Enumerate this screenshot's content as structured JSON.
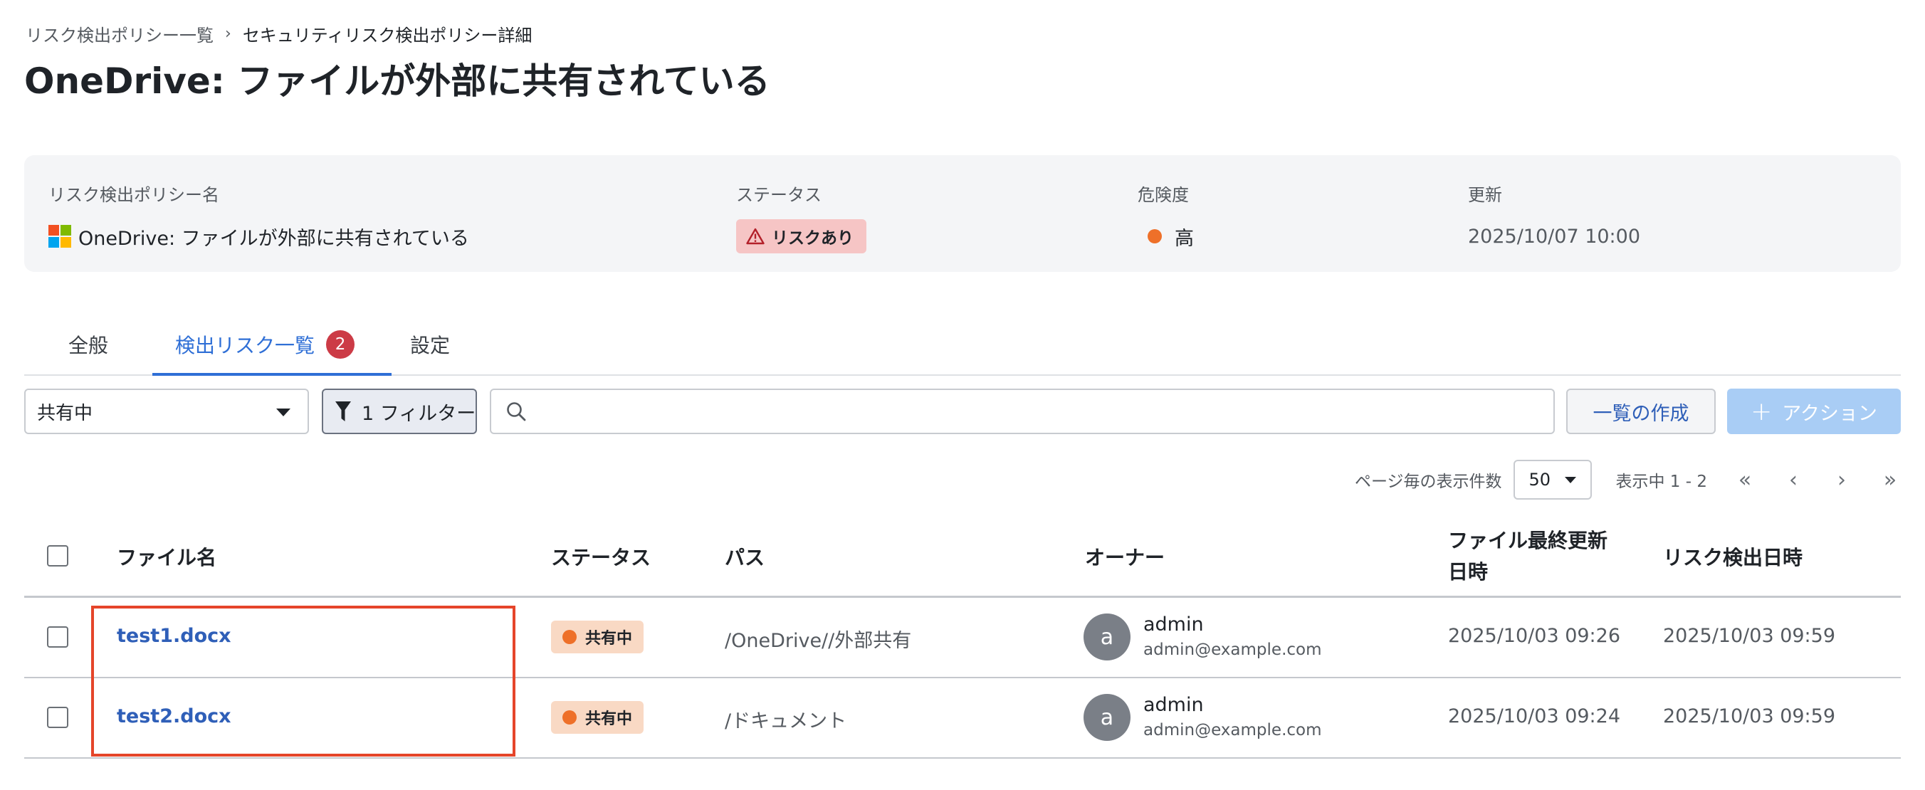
{
  "breadcrumb": {
    "parent": "リスク検出ポリシー一覧",
    "separator": "›",
    "current": "セキュリティリスク検出ポリシー詳細"
  },
  "page_title": "OneDrive: ファイルが外部に共有されている",
  "summary": {
    "policy_label": "リスク検出ポリシー名",
    "policy_value": "OneDrive: ファイルが外部に共有されている",
    "status_label": "ステータス",
    "status_value": "リスクあり",
    "severity_label": "危険度",
    "severity_value": "高",
    "updated_label": "更新",
    "updated_value": "2025/10/07 10:00",
    "icons": {
      "policy": "microsoft-logo-icon",
      "status": "warning-triangle-icon",
      "severity": "orange-dot-icon"
    },
    "colors": {
      "risk_badge_bg": "#f6c5c5",
      "severity_dot": "#ee7029"
    }
  },
  "tabs": [
    {
      "label": "全般",
      "active": false
    },
    {
      "label": "検出リスク一覧",
      "active": true,
      "count": "2"
    },
    {
      "label": "設定",
      "active": false
    }
  ],
  "toolbar": {
    "status_select_value": "共有中",
    "filter_label": "1 フィルター",
    "search_placeholder": "",
    "create_list_label": "一覧の作成",
    "action_label": "アクション",
    "icons": {
      "filter": "funnel-icon",
      "search": "search-icon",
      "action": "plus-icon"
    }
  },
  "pager": {
    "per_page_label": "ページ毎の表示件数",
    "per_page_value": "50",
    "range_label": "表示中 1 - 2",
    "first": "«",
    "prev": "‹",
    "next": "›",
    "last": "»"
  },
  "table": {
    "headers": {
      "file_name": "ファイル名",
      "status": "ステータス",
      "path": "パス",
      "owner": "オーナー",
      "file_updated_1": "ファイル最終更新",
      "file_updated_2": "日時",
      "risk_detected": "リスク検出日時"
    },
    "rows": [
      {
        "file_name": "test1.docx",
        "status": "共有中",
        "path": "/OneDrive//外部共有",
        "owner_initial": "a",
        "owner_name": "admin",
        "owner_email": "admin@example.com",
        "file_updated": "2025/10/03 09:26",
        "risk_detected": "2025/10/03 09:59"
      },
      {
        "file_name": "test2.docx",
        "status": "共有中",
        "path": "/ドキュメント",
        "owner_initial": "a",
        "owner_name": "admin",
        "owner_email": "admin@example.com",
        "file_updated": "2025/10/03 09:24",
        "risk_detected": "2025/10/03 09:59"
      }
    ]
  },
  "colors": {
    "accent": "#2f6fd6",
    "link": "#2f5fb8",
    "highlight_box": "#e5452a",
    "share_badge_bg": "#f9d9c4",
    "tab_count_bg": "#cc3b46"
  }
}
